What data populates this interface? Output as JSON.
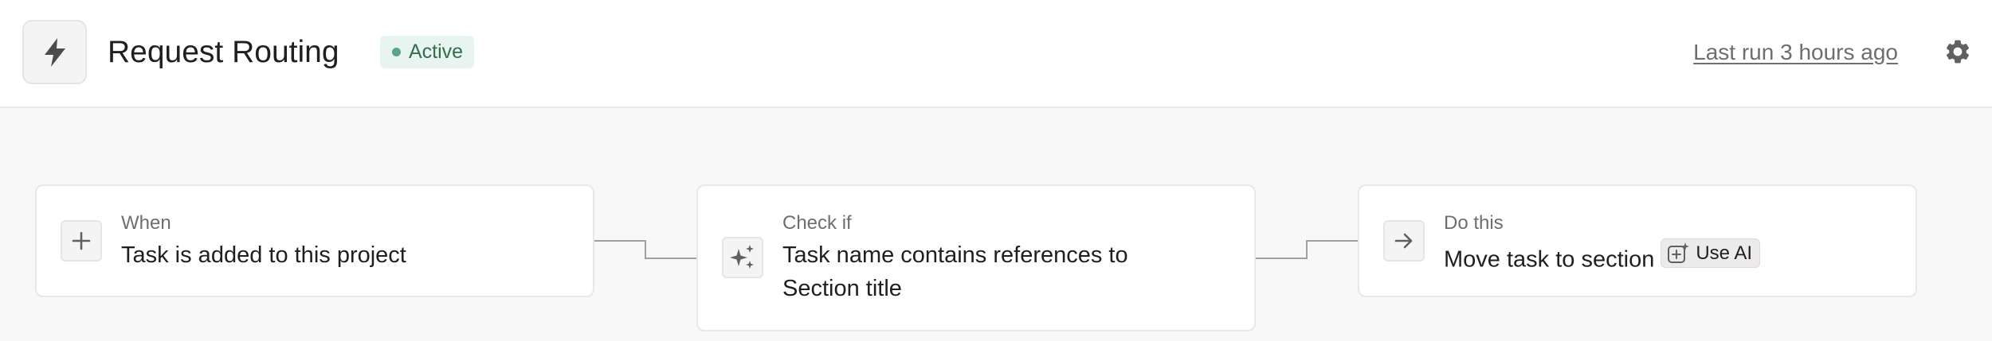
{
  "header": {
    "app_icon": "lightning-bolt-icon",
    "title": "Request Routing",
    "status": "Active",
    "status_color": "#5da283",
    "last_run": "Last run 3 hours ago",
    "settings_icon": "gear-icon"
  },
  "workflow": {
    "steps": [
      {
        "label": "When",
        "text": "Task is added to this project",
        "icon": "plus-icon"
      },
      {
        "label": "Check if",
        "text_lines": [
          "Task name contains references to",
          "Section title"
        ],
        "icon": "sparkles-icon"
      },
      {
        "label": "Do this",
        "text": "Move task to section",
        "icon": "arrow-right-icon",
        "ai_button": "Use AI",
        "ai_icon": "ai-sparkle-plus-icon"
      }
    ]
  }
}
